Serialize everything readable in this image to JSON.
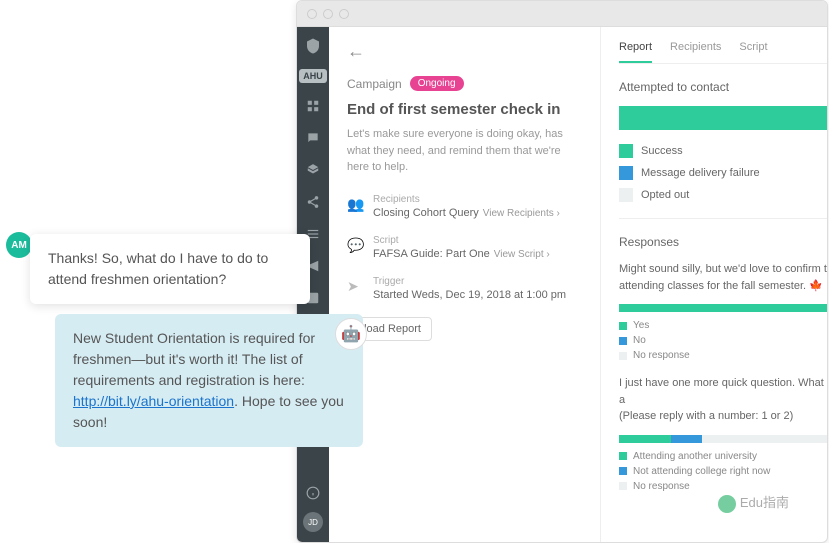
{
  "sidebar": {
    "badge": "AHU",
    "avatar": "JD"
  },
  "campaign": {
    "label": "Campaign",
    "status": "Ongoing",
    "title": "End of first semester check in",
    "description": "Let's make sure everyone is doing okay, has what they need, and remind them that we're here to help."
  },
  "meta": {
    "recipients": {
      "label": "Recipients",
      "value": "Closing Cohort Query",
      "link": "View Recipients ›"
    },
    "script": {
      "label": "Script",
      "value": "FAFSA Guide: Part One",
      "link": "View Script ›"
    },
    "trigger": {
      "label": "Trigger",
      "value": "Started Weds, Dec 19, 2018 at 1:00 pm"
    }
  },
  "download_label": "nload Report",
  "tabs": [
    "Report",
    "Recipients",
    "Script"
  ],
  "report": {
    "attempted_title": "Attempted to contact",
    "legend": [
      "Success",
      "Message delivery failure",
      "Opted out"
    ],
    "responses_title": "Responses",
    "q1": {
      "text": "Might sound silly, but we'd love to confirm t",
      "text2": "attending classes for the fall semester. ",
      "emoji": "🍁",
      "answers": [
        "Yes",
        "No",
        "No response"
      ]
    },
    "q2": {
      "text": "I just have one more quick question. What a",
      "text2": "(Please reply with a number: 1 or 2)",
      "answers": [
        "Attending another university",
        "Not attending college right now",
        "No response"
      ]
    }
  },
  "chat": {
    "avatar": "AM",
    "msg1": "Thanks! So, what do I have to do to attend freshmen orientation?",
    "msg2_a": "New Student Orientation is required for freshmen—but it's worth it! The list of requirements and registration is here: ",
    "msg2_link": "http://bit.ly/ahu-orientation",
    "msg2_b": ". Hope to see you soon!"
  },
  "watermark": "Edu指南"
}
